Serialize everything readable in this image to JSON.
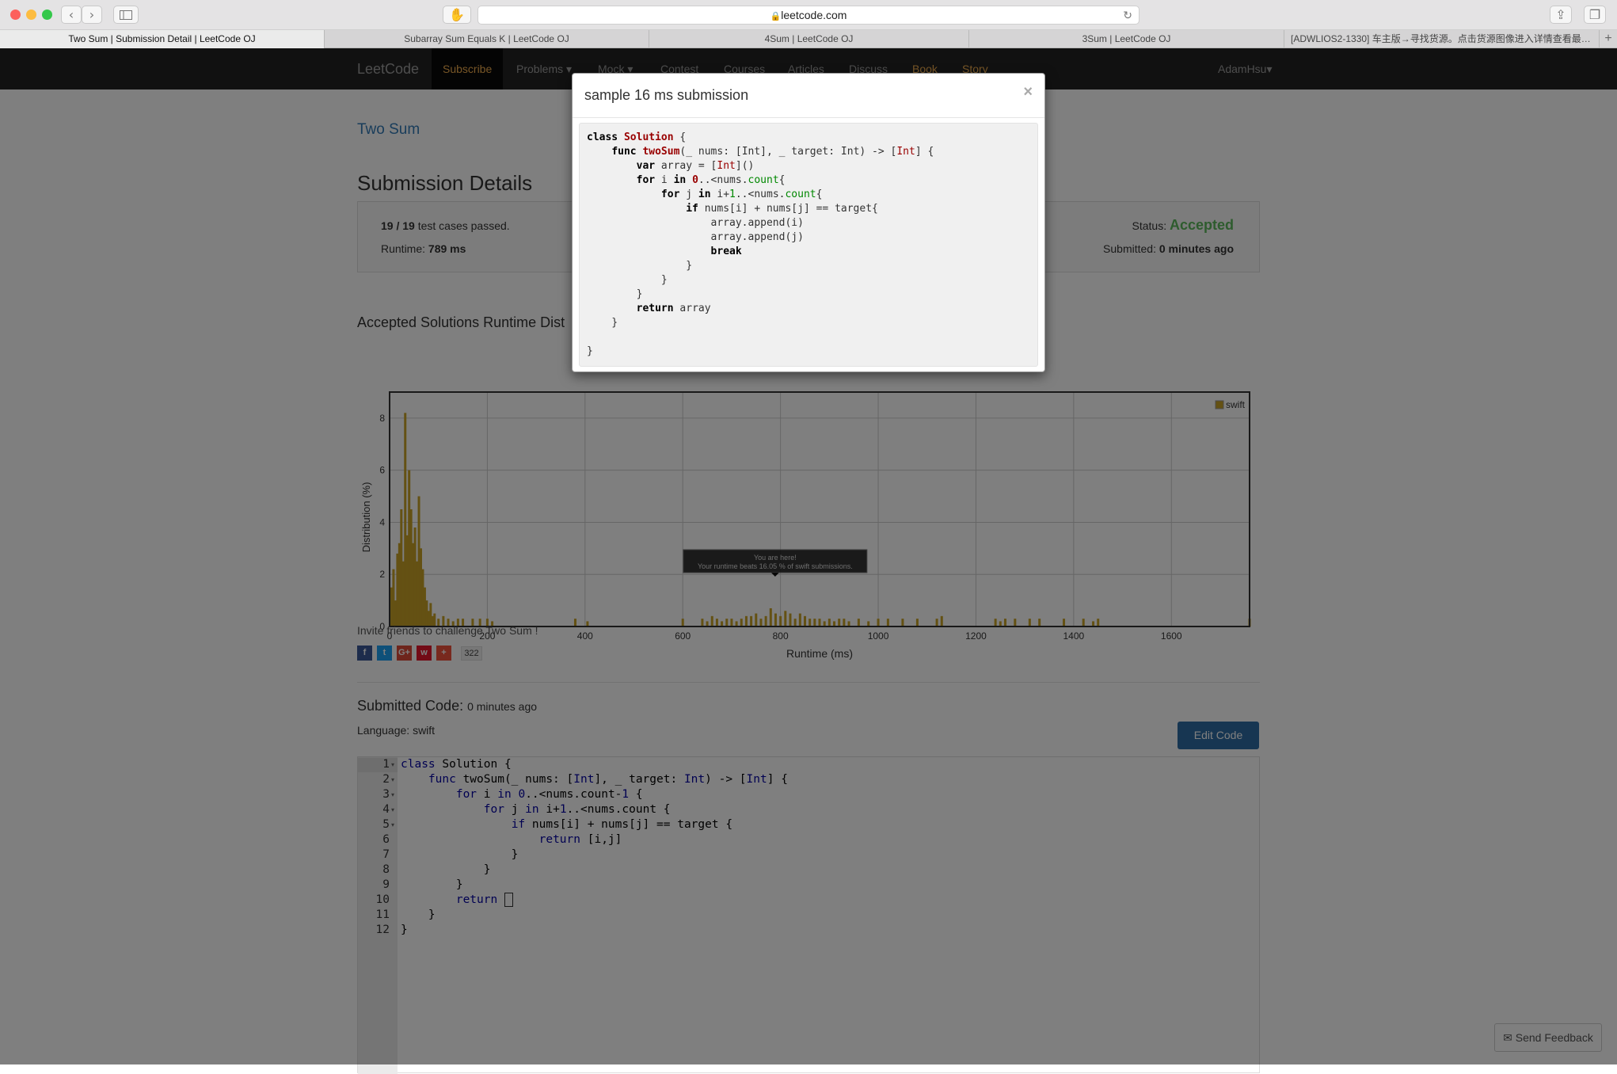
{
  "browser": {
    "url": "leetcode.com",
    "tabs": [
      "Two Sum | Submission Detail | LeetCode OJ",
      "Subarray Sum Equals K | LeetCode OJ",
      "4Sum | LeetCode OJ",
      "3Sum | LeetCode OJ",
      "[ADWLIOS2-1330] 车主版→寻找货源。点击货源图像进入详情查看最新..."
    ]
  },
  "nav": {
    "brand": "LeetCode",
    "subscribe": "Subscribe",
    "problems": "Problems",
    "mock": "Mock",
    "contest": "Contest",
    "courses": "Courses",
    "articles": "Articles",
    "discuss": "Discuss",
    "book": "Book",
    "story": "Story",
    "user": "AdamHsu"
  },
  "problem_title": "Two Sum",
  "details": {
    "heading": "Submission Details",
    "passed": "19 / 19",
    "passed_suffix": " test cases passed.",
    "runtime_label": "Runtime: ",
    "runtime_value": "789 ms",
    "status_label": "Status: ",
    "status_value": "Accepted",
    "submitted_label": "Submitted: ",
    "submitted_value": "0 minutes ago"
  },
  "runtime_heading": "Accepted Solutions Runtime Dist",
  "chart_data": {
    "type": "bar",
    "xlabel": "Runtime (ms)",
    "ylabel": "Distribution (%)",
    "xlim": [
      0,
      1760
    ],
    "ylim": [
      0,
      9
    ],
    "xticks": [
      0,
      200,
      400,
      600,
      800,
      1000,
      1200,
      1400,
      1600
    ],
    "yticks": [
      0,
      2,
      4,
      6,
      8
    ],
    "legend": "swift",
    "legend_position": "top-right",
    "grid": true,
    "color": "#c9a227",
    "tooltip": [
      "You are here!",
      "Your runtime beats 16.05 % of swift submissions."
    ],
    "marker_x": 789,
    "x": [
      4,
      8,
      12,
      16,
      20,
      24,
      28,
      32,
      36,
      40,
      44,
      48,
      52,
      56,
      60,
      64,
      68,
      72,
      76,
      80,
      84,
      88,
      92,
      100,
      110,
      120,
      130,
      140,
      150,
      170,
      185,
      200,
      210,
      380,
      405,
      600,
      640,
      650,
      660,
      670,
      680,
      690,
      700,
      710,
      720,
      730,
      740,
      750,
      760,
      770,
      780,
      790,
      800,
      810,
      820,
      830,
      840,
      850,
      860,
      870,
      880,
      890,
      900,
      910,
      920,
      930,
      940,
      960,
      980,
      1000,
      1020,
      1050,
      1080,
      1120,
      1130,
      1240,
      1250,
      1260,
      1280,
      1310,
      1330,
      1380,
      1420,
      1440,
      1450,
      1760
    ],
    "values": [
      1.5,
      2.2,
      1.0,
      2.8,
      3.2,
      4.5,
      2.5,
      8.2,
      3.5,
      6.0,
      4.5,
      3.2,
      3.8,
      2.5,
      5.0,
      3.0,
      2.2,
      1.5,
      1.0,
      0.6,
      0.9,
      0.4,
      0.5,
      0.3,
      0.4,
      0.3,
      0.2,
      0.3,
      0.3,
      0.3,
      0.3,
      0.3,
      0.2,
      0.3,
      0.2,
      0.3,
      0.3,
      0.2,
      0.4,
      0.3,
      0.2,
      0.3,
      0.3,
      0.2,
      0.3,
      0.4,
      0.4,
      0.5,
      0.3,
      0.4,
      0.7,
      0.5,
      0.4,
      0.6,
      0.5,
      0.3,
      0.5,
      0.4,
      0.3,
      0.3,
      0.3,
      0.2,
      0.3,
      0.2,
      0.3,
      0.3,
      0.2,
      0.3,
      0.2,
      0.3,
      0.3,
      0.3,
      0.3,
      0.3,
      0.4,
      0.3,
      0.2,
      0.3,
      0.3,
      0.3,
      0.3,
      0.3,
      0.3,
      0.2,
      0.3,
      0.3
    ]
  },
  "invite_text": "Invite friends to challenge Two Sum !",
  "share_count": "322",
  "submitted_code": {
    "heading": "Submitted Code:",
    "ago": "0 minutes ago",
    "language": "Language: swift",
    "edit_button": "Edit Code",
    "line_numbers": [
      "1",
      "2",
      "3",
      "4",
      "5",
      "6",
      "7",
      "8",
      "9",
      "10",
      "11",
      "12"
    ]
  },
  "feedback_label": "Send Feedback",
  "modal": {
    "title": "sample 16 ms submission",
    "close": "×"
  }
}
